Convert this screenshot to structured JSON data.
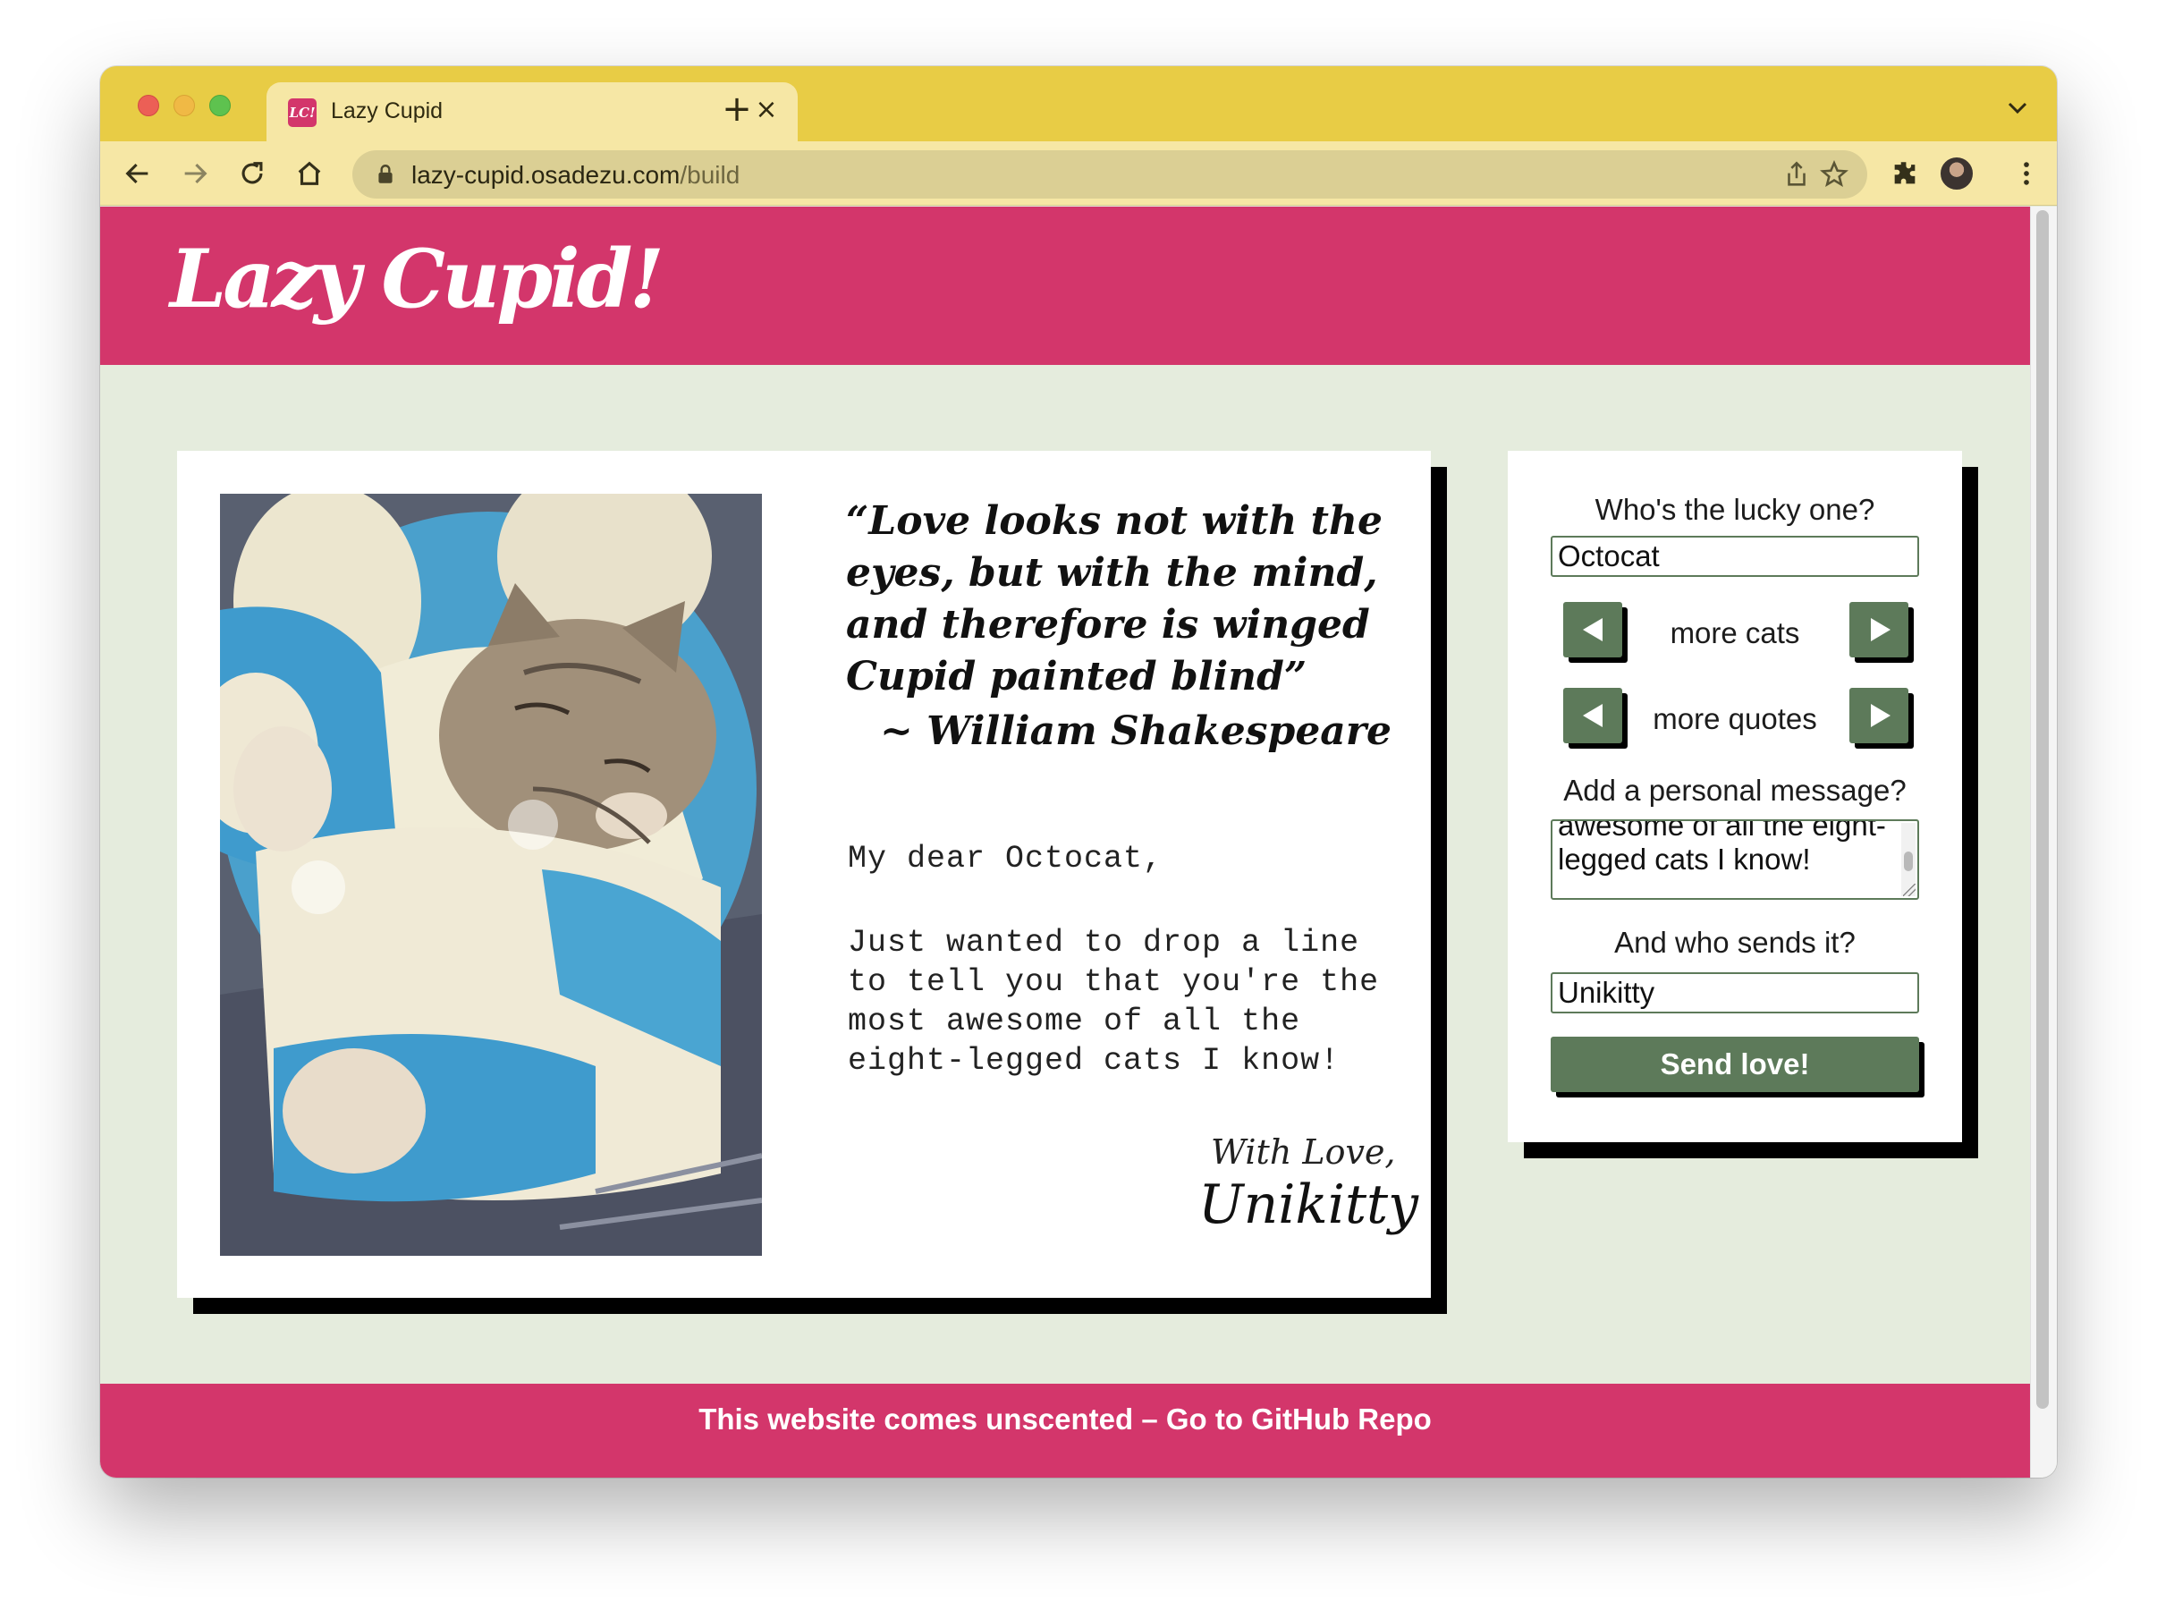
{
  "browser": {
    "tab": {
      "title": "Lazy Cupid",
      "favicon_text": "LC!"
    },
    "url": {
      "host": "lazy-cupid.osadezu.com",
      "path": "/build"
    },
    "icons": [
      "back-arrow-icon",
      "forward-arrow-icon",
      "reload-icon",
      "home-icon",
      "lock-icon",
      "share-icon",
      "star-icon",
      "extensions-icon",
      "profile-avatar",
      "kebab-menu-icon"
    ]
  },
  "header": {
    "logo": "Lazy Cupid!"
  },
  "card": {
    "quote": "“Love looks not with the eyes, but with the mind, and therefore is winged Cupid painted blind”",
    "quote_author": "~ William Shakespeare",
    "greeting": "My dear Octocat,",
    "body": "Just wanted to drop a line to tell you that you're the most awesome of all the eight-legged cats I know!",
    "closing": "With Love,",
    "signature": "Unikitty"
  },
  "form": {
    "recipient_label": "Who's the lucky one?",
    "recipient_value": "Octocat",
    "cats_label": "more cats",
    "quotes_label": "more quotes",
    "message_label": "Add a personal message?",
    "message_value": "awesome of all the eight-legged cats I know!",
    "sender_label": "And who sends it?",
    "sender_value": "Unikitty",
    "submit_label": "Send love!"
  },
  "footer": {
    "text": "This website comes unscented – Go to GitHub Repo"
  },
  "colors": {
    "brand_pink": "#d3366b",
    "page_background": "#e5ecdd",
    "button_green": "#5d7a5a",
    "tab_strip": "#e8cc45",
    "toolbar": "#f6e7a5"
  }
}
